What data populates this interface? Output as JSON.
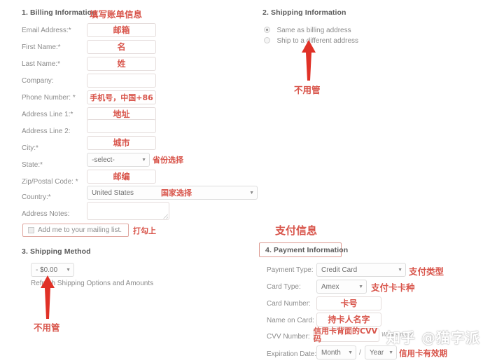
{
  "billing": {
    "title": "1. Billing Information",
    "title_note": "填写账单信息",
    "fields": [
      {
        "label": "Email Address:*",
        "value": "邮箱"
      },
      {
        "label": "First Name:*",
        "value": "名"
      },
      {
        "label": "Last Name:*",
        "value": "姓"
      },
      {
        "label": "Company:",
        "value": ""
      },
      {
        "label": "Phone Number: *",
        "value": "手机号，中国+86"
      },
      {
        "label": "Address Line 1:*",
        "value": "地址"
      },
      {
        "label": "Address Line 2:",
        "value": ""
      },
      {
        "label": "City:*",
        "value": "城市"
      }
    ],
    "state": {
      "label": "State:*",
      "value": "-select-",
      "note": "省份选择"
    },
    "zip": {
      "label": "Zip/Postal Code: *",
      "value": "邮编"
    },
    "country": {
      "label": "Country:*",
      "value": "United States",
      "note": "国家选择"
    },
    "address_notes": {
      "label": "Address Notes:",
      "value": ""
    },
    "mailing": {
      "label": "Add me to your mailing list.",
      "note": "打勾上"
    }
  },
  "shipping_info": {
    "title": "2. Shipping Information",
    "options": [
      {
        "label": "Same as billing address",
        "selected": true
      },
      {
        "label": "Ship to a different address",
        "selected": false
      }
    ],
    "note": "不用管"
  },
  "shipping_method": {
    "title": "3. Shipping Method",
    "select_value": "- $0.00",
    "refresh_label": "Refresh Shipping Options and Amounts",
    "note": "不用管"
  },
  "payment": {
    "heading_note": "支付信息",
    "title": "4. Payment Information",
    "rows": [
      {
        "label": "Payment Type:",
        "value": "Credit Card",
        "note": "支付类型"
      },
      {
        "label": "Card Type:",
        "value": "Amex",
        "note": "支付卡卡种"
      },
      {
        "label": "Card Number:",
        "value": "卡号",
        "note": ""
      },
      {
        "label": "Name on Card:",
        "value": "持卡人名字",
        "note": ""
      }
    ],
    "cvv": {
      "label": "CVV Number:",
      "value": "信用卡背面的CVV码",
      "help": "What's this?"
    },
    "expiration": {
      "label": "Expiration Date:",
      "month": "Month",
      "separator": "/",
      "year": "Year",
      "note": "信用卡有效期"
    }
  },
  "watermark": {
    "text": "知乎 @猫字派"
  },
  "colors": {
    "annotation_red": "#d8544a",
    "arrow_red": "#e03127",
    "label_gray": "#8b8b8b",
    "input_border": "#e4dcdb",
    "select_border": "#dcdcdc"
  }
}
